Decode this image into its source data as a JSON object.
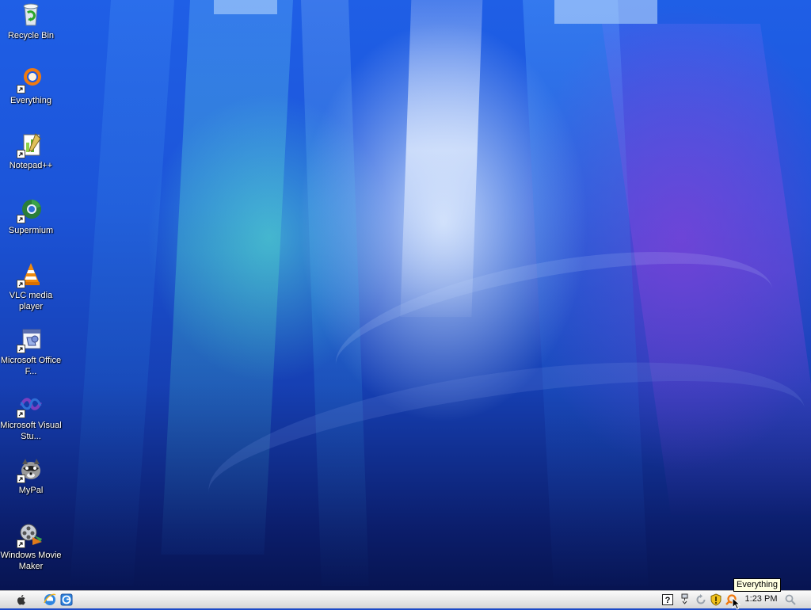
{
  "desktop": {
    "icons": [
      {
        "label": "Recycle Bin",
        "icon": "recycle-bin-icon",
        "shortcut": false
      },
      {
        "label": "Everything",
        "icon": "everything-icon",
        "shortcut": true
      },
      {
        "label": "Notepad++",
        "icon": "notepadpp-icon",
        "shortcut": true
      },
      {
        "label": "Supermium",
        "icon": "supermium-icon",
        "shortcut": true
      },
      {
        "label": "VLC media player",
        "icon": "vlc-icon",
        "shortcut": true
      },
      {
        "label": "Microsoft Office F...",
        "icon": "office-icon",
        "shortcut": true
      },
      {
        "label": "Microsoft Visual Stu...",
        "icon": "visual-studio-icon",
        "shortcut": true
      },
      {
        "label": "MyPal",
        "icon": "mypal-icon",
        "shortcut": true
      },
      {
        "label": "Windows Movie Maker",
        "icon": "movie-maker-icon",
        "shortcut": true
      }
    ]
  },
  "taskbar": {
    "start_icon": "apple-logo-icon",
    "quick_launch": [
      "internet-explorer-icon",
      "browser-icon"
    ],
    "tray": [
      "help-icon",
      "network-icon",
      "update-icon",
      "security-shield-icon",
      "everything-icon"
    ],
    "clock": "1:23 PM",
    "search_icon": "magnifier-icon"
  },
  "tooltip": {
    "text": "Everything"
  },
  "colors": {
    "wallpaper_primary": "#1c54d8",
    "wallpaper_accent": "#7a40d0",
    "taskbar": "#e9e9e9",
    "tooltip_bg": "#ffffe1"
  }
}
